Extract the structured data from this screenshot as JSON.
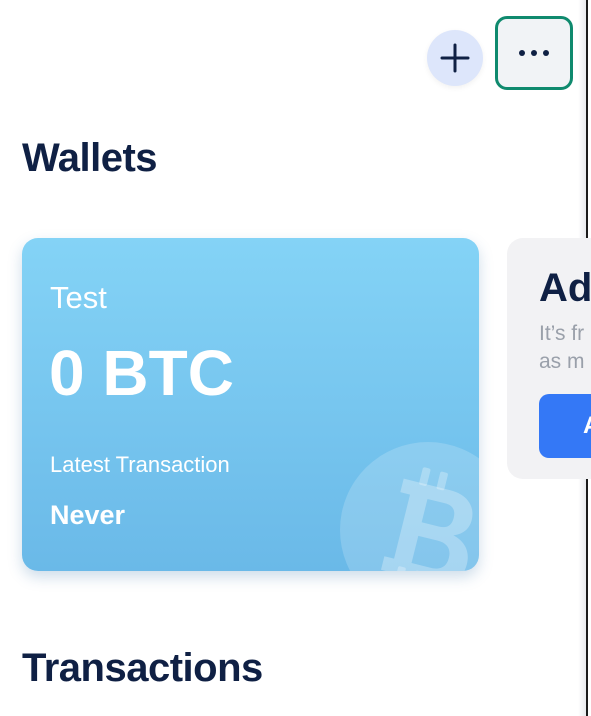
{
  "header": {
    "add_icon": "plus-icon",
    "more_icon": "ellipsis-icon"
  },
  "sections": {
    "wallets_title": "Wallets",
    "transactions_title": "Transactions"
  },
  "wallet_card": {
    "name": "Test",
    "balance": "0 BTC",
    "latest_label": "Latest Transaction",
    "latest_value": "Never",
    "watermark_icon": "bitcoin-icon",
    "gradient_top": "#84d3f6",
    "gradient_bottom": "#6ab9e8"
  },
  "add_wallet_card": {
    "title": "Ad",
    "description_line1": "It’s fr",
    "description_line2": "as m",
    "button_label": "A",
    "button_color": "#3478f6"
  },
  "colors": {
    "title": "#0f2044",
    "highlight_border": "#0f8a6e",
    "add_button_bg": "#dde6fb"
  }
}
